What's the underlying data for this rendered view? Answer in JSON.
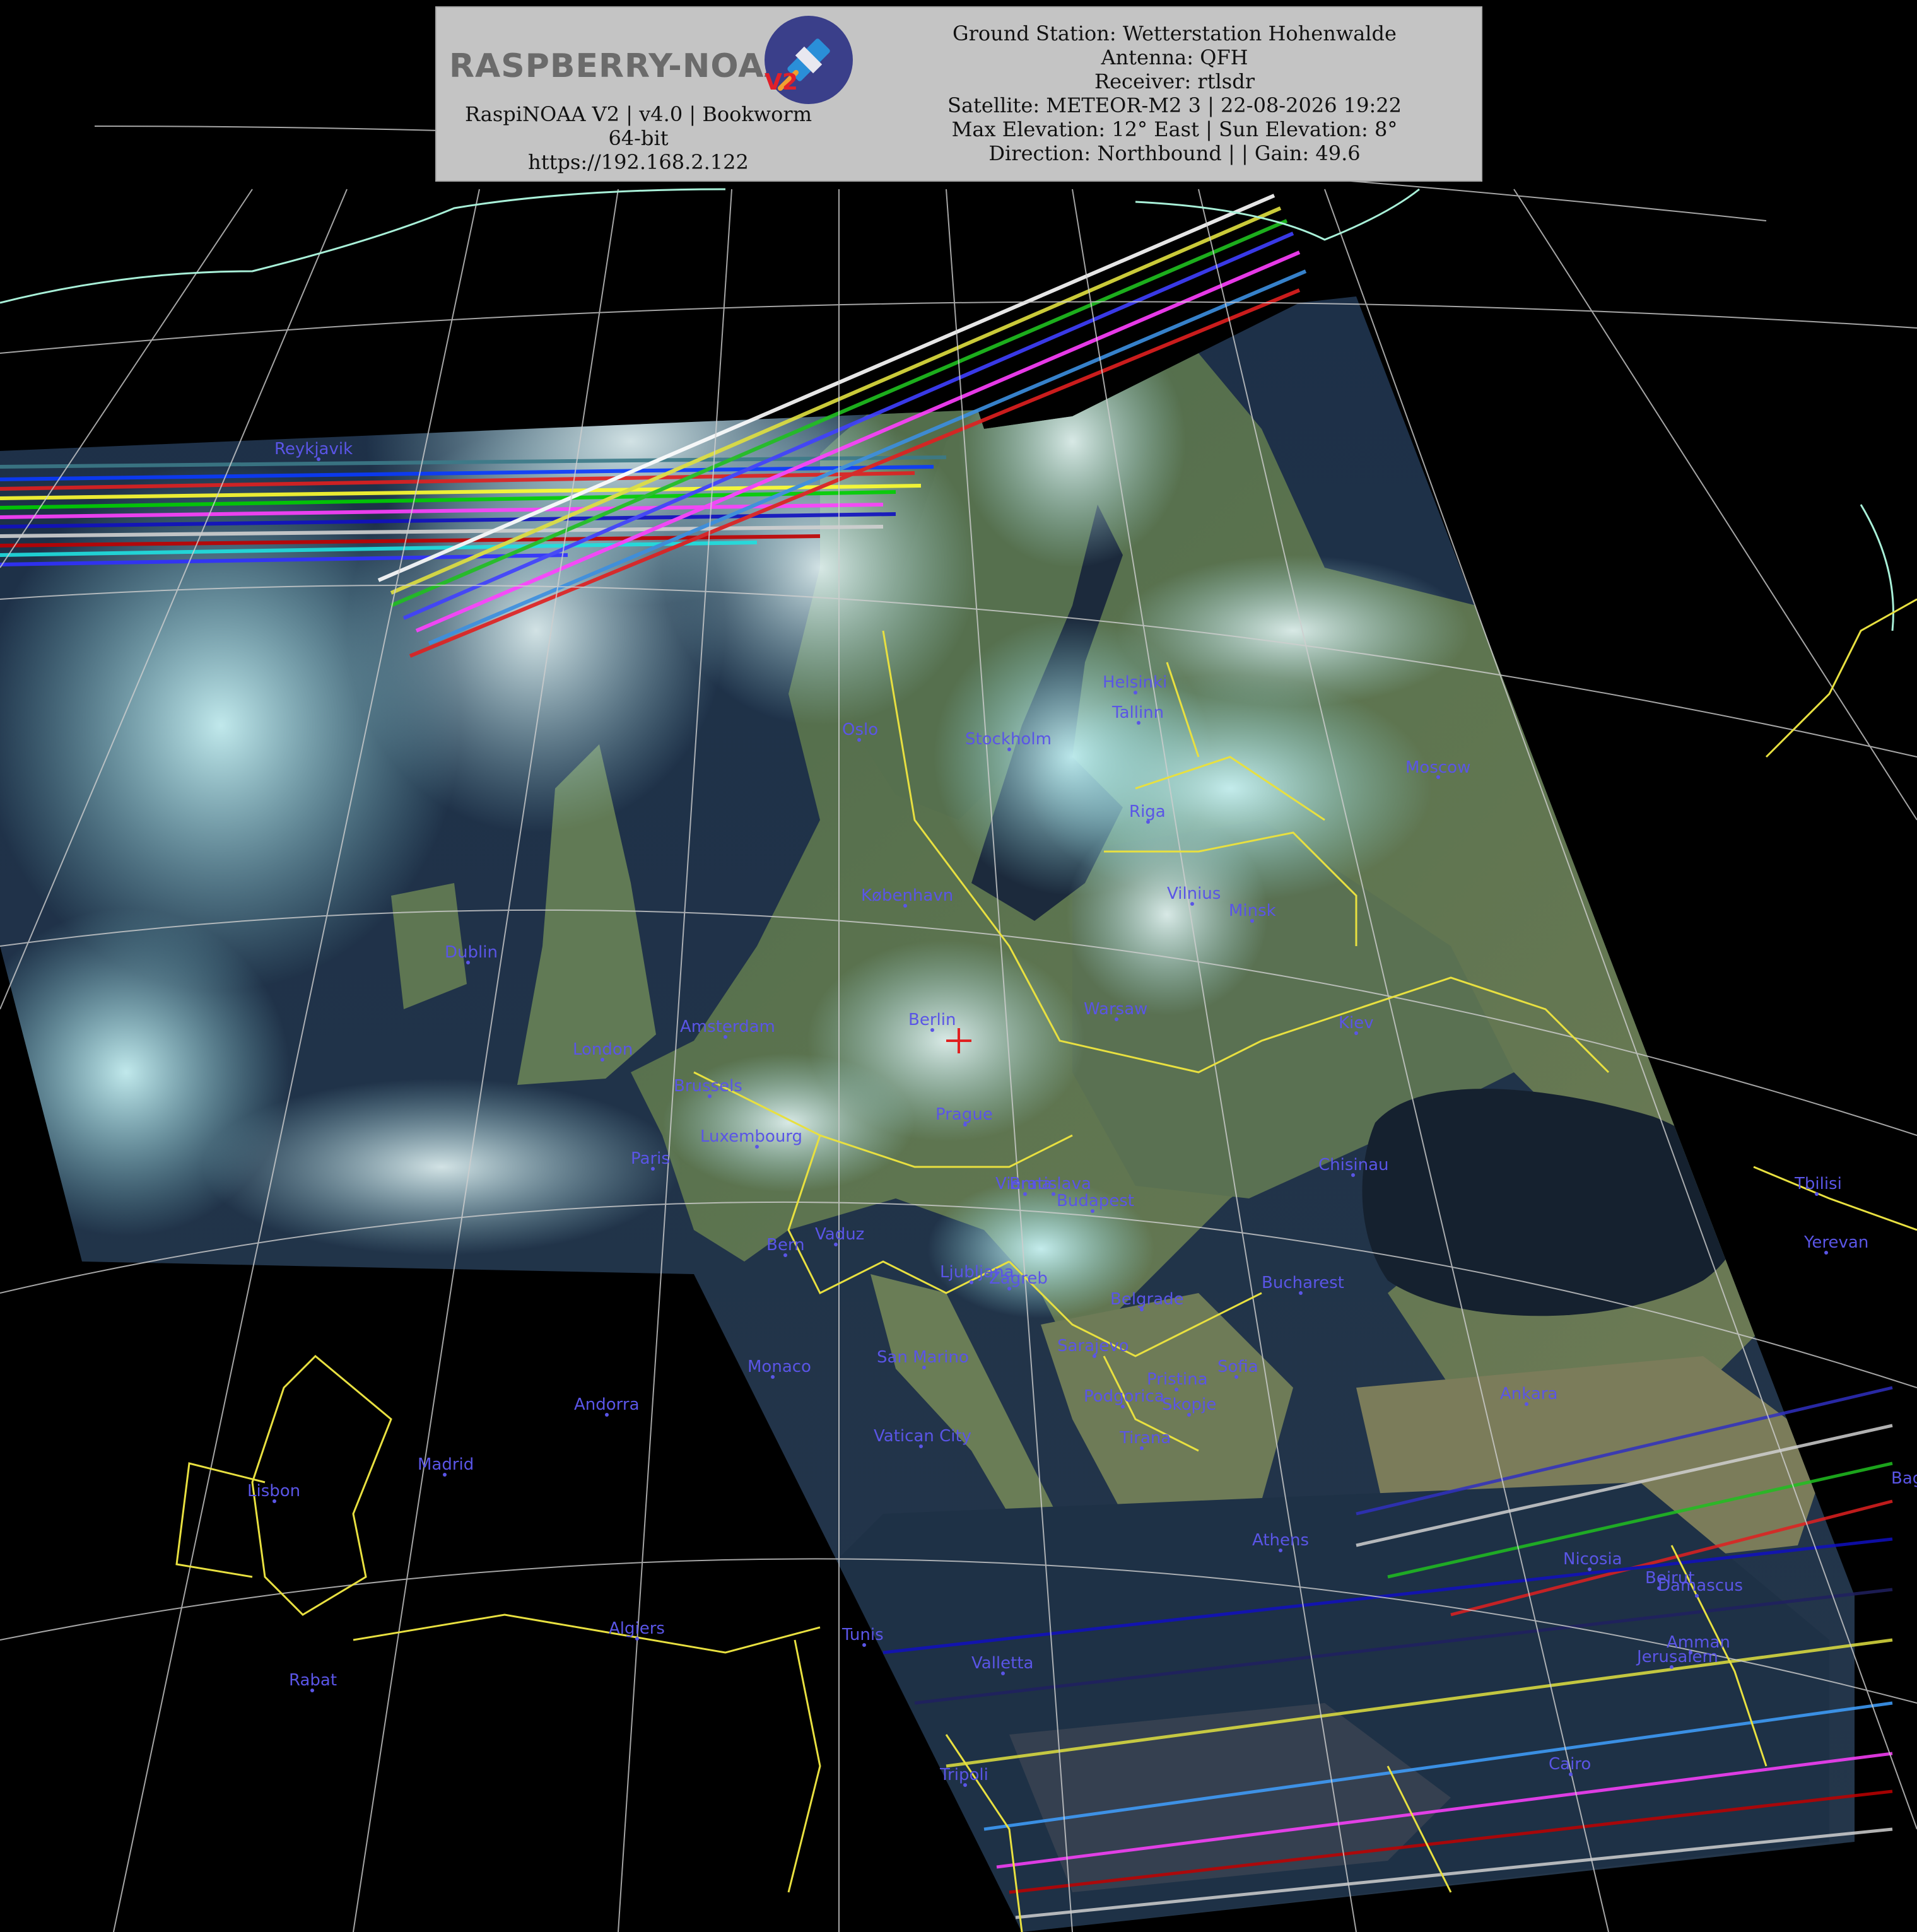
{
  "header": {
    "logo_text": "RASPBERRY-NOAA",
    "logo_sub": "V2",
    "app_line": "RaspiNOAA V2 | v4.0 | Bookworm 64-bit",
    "url": "https://192.168.2.122",
    "ground_station": "Ground Station: Wetterstation Hohenwalde",
    "antenna": "Antenna: QFH",
    "receiver": "Receiver: rtlsdr",
    "satellite": "Satellite: METEOR-M2 3 | 22-08-2026 19:22",
    "elevation": "Max Elevation: 12° East | Sun Elevation: 8°",
    "direction": "Direction: Northbound | | Gain: 49.6"
  },
  "colors": {
    "city_label": "#5a55e6",
    "border_line": "#e8e040",
    "coastline": "#a8f0d8",
    "grid": "#cfcfcf",
    "station_marker": "#e02020"
  },
  "cities": [
    "Reykjavik",
    "Helsinki",
    "Tallinn",
    "Oslo",
    "Stockholm",
    "Moscow",
    "Riga",
    "København",
    "Vilnius",
    "Minsk",
    "Dublin",
    "Amsterdam",
    "Berlin",
    "Warsaw",
    "Kiev",
    "London",
    "Brussels",
    "Prague",
    "Luxembourg",
    "Paris",
    "Chisinau",
    "Vienna",
    "Bratislava",
    "Budapest",
    "Tbilisi",
    "Bern",
    "Vaduz",
    "Yerevan",
    "Ljubljana",
    "Zagreb",
    "Bucharest",
    "Belgrade",
    "Monaco",
    "San Marino",
    "Sarajevo",
    "Sofia",
    "Andorra",
    "Pristina",
    "Podgorica",
    "Skopje",
    "Ankara",
    "Vatican City",
    "Tirana",
    "Madrid",
    "Lisbon",
    "Athens",
    "Nicosia",
    "Beirut",
    "Damascus",
    "Baghdad",
    "Algiers",
    "Tunis",
    "Valletta",
    "Amman",
    "Jerusalem",
    "Rabat",
    "Tripoli",
    "Cairo"
  ]
}
